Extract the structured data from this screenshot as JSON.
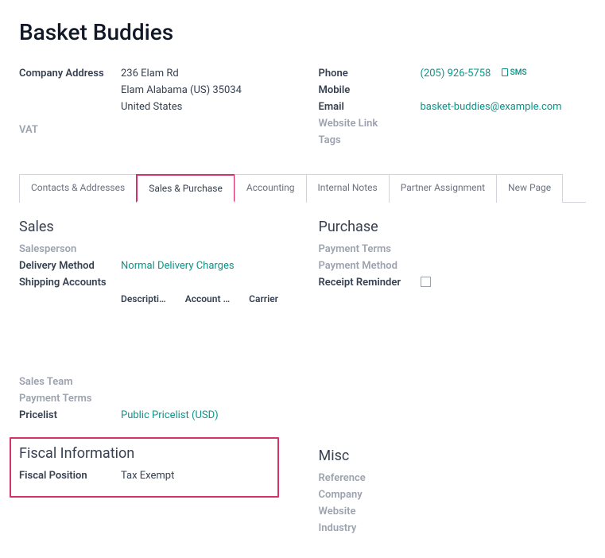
{
  "title": "Basket Buddies",
  "left": {
    "company_address_label": "Company Address",
    "address_line1": "236 Elam Rd",
    "address_line2": "Elam  Alabama (US)  35034",
    "address_line3": "United States",
    "vat_label": "VAT"
  },
  "right": {
    "phone_label": "Phone",
    "phone_value": "(205) 926-5758",
    "sms_label": "SMS",
    "mobile_label": "Mobile",
    "email_label": "Email",
    "email_value": "basket-buddies@example.com",
    "website_label": "Website Link",
    "tags_label": "Tags"
  },
  "tabs": {
    "contacts": "Contacts & Addresses",
    "sales": "Sales & Purchase",
    "accounting": "Accounting",
    "notes": "Internal Notes",
    "partner": "Partner Assignment",
    "new": "New Page"
  },
  "sales": {
    "heading": "Sales",
    "salesperson_label": "Salesperson",
    "delivery_label": "Delivery Method",
    "delivery_value": "Normal Delivery Charges",
    "shipping_label": "Shipping Accounts",
    "col1": "Descripti…",
    "col2": "Account …",
    "col3": "Carrier",
    "salesteam_label": "Sales Team",
    "payment_terms_label": "Payment Terms",
    "pricelist_label": "Pricelist",
    "pricelist_value": "Public Pricelist (USD)"
  },
  "purchase": {
    "heading": "Purchase",
    "payment_terms_label": "Payment Terms",
    "payment_method_label": "Payment Method",
    "receipt_label": "Receipt Reminder"
  },
  "fiscal": {
    "heading": "Fiscal Information",
    "position_label": "Fiscal Position",
    "position_value": "Tax Exempt"
  },
  "misc": {
    "heading": "Misc",
    "reference_label": "Reference",
    "company_label": "Company",
    "website_label": "Website",
    "industry_label": "Industry"
  }
}
